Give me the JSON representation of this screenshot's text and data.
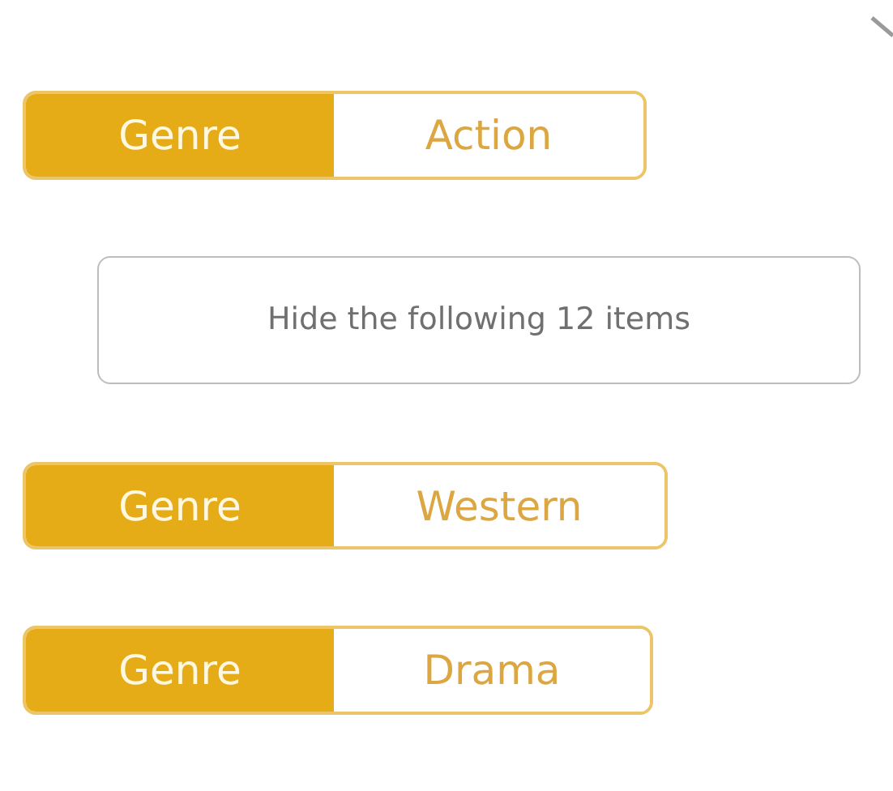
{
  "items": [
    {
      "kind": "tag",
      "key": "Genre",
      "value": "Action"
    },
    {
      "kind": "button",
      "label": "Hide the following 12 items"
    },
    {
      "kind": "tag",
      "key": "Genre",
      "value": "Western"
    },
    {
      "kind": "tag",
      "key": "Genre",
      "value": "Drama"
    }
  ]
}
